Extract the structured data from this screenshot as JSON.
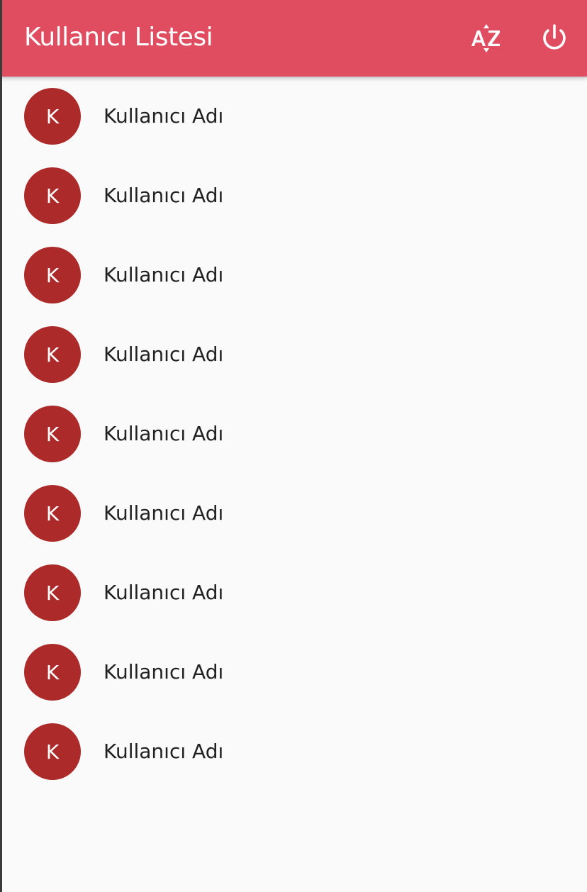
{
  "app_bar": {
    "title": "Kullanıcı Listesi",
    "background_color": "#e14d60",
    "actions": [
      {
        "icon": "sort-by-alpha-icon"
      },
      {
        "icon": "power-icon"
      }
    ]
  },
  "users": [
    {
      "initial": "K",
      "name": "Kullanıcı Adı"
    },
    {
      "initial": "K",
      "name": "Kullanıcı Adı"
    },
    {
      "initial": "K",
      "name": "Kullanıcı Adı"
    },
    {
      "initial": "K",
      "name": "Kullanıcı Adı"
    },
    {
      "initial": "K",
      "name": "Kullanıcı Adı"
    },
    {
      "initial": "K",
      "name": "Kullanıcı Adı"
    },
    {
      "initial": "K",
      "name": "Kullanıcı Adı"
    },
    {
      "initial": "K",
      "name": "Kullanıcı Adı"
    },
    {
      "initial": "K",
      "name": "Kullanıcı Adı"
    }
  ],
  "avatar_color": "#ad2a2a"
}
